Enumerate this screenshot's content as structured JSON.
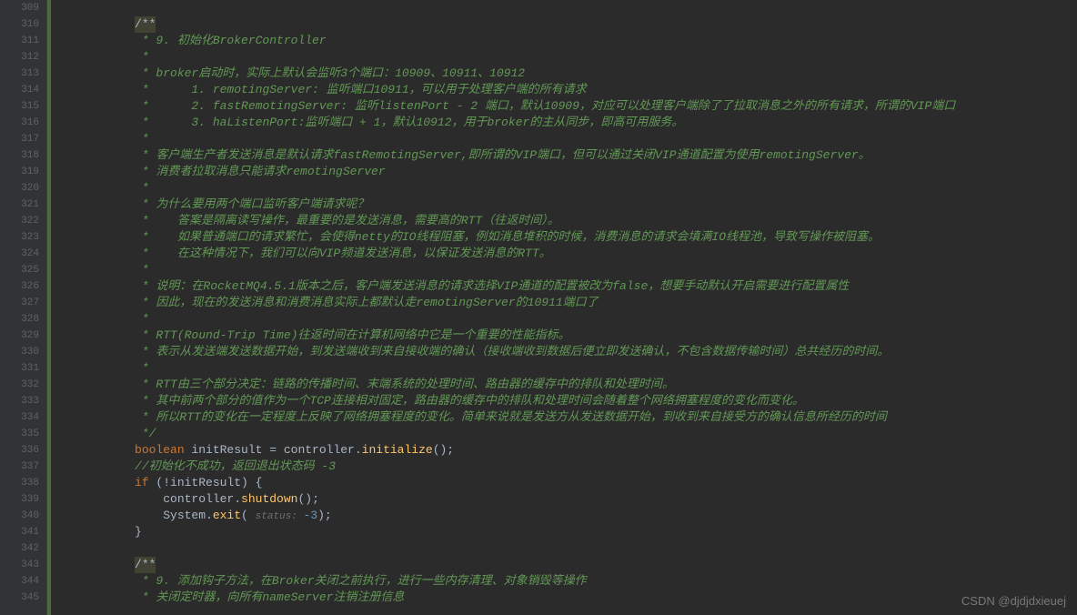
{
  "gutter": {
    "start": 309,
    "end": 345
  },
  "lines": [
    {
      "num": 309,
      "indent": "          ",
      "segments": []
    },
    {
      "num": 310,
      "indent": "          ",
      "segments": [
        {
          "type": "doc-bg",
          "text": "/**"
        }
      ]
    },
    {
      "num": 311,
      "indent": "          ",
      "segments": [
        {
          "type": "doc-comment",
          "text": " * 9. 初始化BrokerController"
        }
      ]
    },
    {
      "num": 312,
      "indent": "          ",
      "segments": [
        {
          "type": "doc-comment",
          "text": " *"
        }
      ]
    },
    {
      "num": 313,
      "indent": "          ",
      "segments": [
        {
          "type": "doc-comment",
          "text": " * broker启动时，实际上默认会监听3个端口：10909、10911、10912"
        }
      ]
    },
    {
      "num": 314,
      "indent": "          ",
      "segments": [
        {
          "type": "doc-comment",
          "text": " *      1. remotingServer: 监听端口10911，可以用于处理客户端的所有请求"
        }
      ]
    },
    {
      "num": 315,
      "indent": "          ",
      "segments": [
        {
          "type": "doc-comment",
          "text": " *      2. fastRemotingServer: 监听listenPort - 2 端口，默认10909，对应可以处理客户端除了了拉取消息之外的所有请求，所谓的VIP端口"
        }
      ]
    },
    {
      "num": 316,
      "indent": "          ",
      "segments": [
        {
          "type": "doc-comment",
          "text": " *      3. haListenPort:监听端口 + 1，默认10912，用于broker的主从同步，即高可用服务。"
        }
      ]
    },
    {
      "num": 317,
      "indent": "          ",
      "segments": [
        {
          "type": "doc-comment",
          "text": " *"
        }
      ]
    },
    {
      "num": 318,
      "indent": "          ",
      "segments": [
        {
          "type": "doc-comment",
          "text": " * 客户端生产者发送消息是默认请求fastRemotingServer,即所谓的VIP端口，但可以通过关闭VIP通道配置为使用remotingServer。"
        }
      ]
    },
    {
      "num": 319,
      "indent": "          ",
      "segments": [
        {
          "type": "doc-comment",
          "text": " * 消费者拉取消息只能请求remotingServer"
        }
      ]
    },
    {
      "num": 320,
      "indent": "          ",
      "segments": [
        {
          "type": "doc-comment",
          "text": " *"
        }
      ]
    },
    {
      "num": 321,
      "indent": "          ",
      "segments": [
        {
          "type": "doc-comment",
          "text": " * 为什么要用两个端口监听客户端请求呢？"
        }
      ]
    },
    {
      "num": 322,
      "indent": "          ",
      "segments": [
        {
          "type": "doc-comment",
          "text": " *    答案是隔离读写操作，最重要的是发送消息，需要高的RTT（往返时间）。"
        }
      ]
    },
    {
      "num": 323,
      "indent": "          ",
      "segments": [
        {
          "type": "doc-comment",
          "text": " *    如果普通端口的请求繁忙，会使得netty的IO线程阻塞，例如消息堆积的时候，消费消息的请求会填满IO线程池，导致写操作被阻塞。"
        }
      ]
    },
    {
      "num": 324,
      "indent": "          ",
      "segments": [
        {
          "type": "doc-comment",
          "text": " *    在这种情况下，我们可以向VIP频道发送消息，以保证发送消息的RTT。"
        }
      ]
    },
    {
      "num": 325,
      "indent": "          ",
      "segments": [
        {
          "type": "doc-comment",
          "text": " *"
        }
      ]
    },
    {
      "num": 326,
      "indent": "          ",
      "segments": [
        {
          "type": "doc-comment",
          "text": " * 说明：在RocketMQ4.5.1版本之后，客户端发送消息的请求选择VIP通道的配置被改为false，想要手动默认开启需要进行配置属性"
        }
      ]
    },
    {
      "num": 327,
      "indent": "          ",
      "segments": [
        {
          "type": "doc-comment",
          "text": " * 因此，现在的发送消息和消费消息实际上都默认走remotingServer的10911端口了"
        }
      ]
    },
    {
      "num": 328,
      "indent": "          ",
      "segments": [
        {
          "type": "doc-comment",
          "text": " *"
        }
      ]
    },
    {
      "num": 329,
      "indent": "          ",
      "segments": [
        {
          "type": "doc-comment",
          "text": " * RTT(Round-Trip Time)往返时间在计算机网络中它是一个重要的性能指标。"
        }
      ]
    },
    {
      "num": 330,
      "indent": "          ",
      "segments": [
        {
          "type": "doc-comment",
          "text": " * 表示从发送端发送数据开始，到发送端收到来自接收端的确认（接收端收到数据后便立即发送确认，不包含数据传输时间）总共经历的时间。"
        }
      ]
    },
    {
      "num": 331,
      "indent": "          ",
      "segments": [
        {
          "type": "doc-comment",
          "text": " *"
        }
      ]
    },
    {
      "num": 332,
      "indent": "          ",
      "segments": [
        {
          "type": "doc-comment",
          "text": " * RTT由三个部分决定：链路的传播时间、末端系统的处理时间、路由器的缓存中的排队和处理时间。"
        }
      ]
    },
    {
      "num": 333,
      "indent": "          ",
      "segments": [
        {
          "type": "doc-comment",
          "text": " * 其中前两个部分的值作为一个TCP连接相对固定，路由器的缓存中的排队和处理时间会随着整个网络拥塞程度的变化而变化。"
        }
      ]
    },
    {
      "num": 334,
      "indent": "          ",
      "segments": [
        {
          "type": "doc-comment",
          "text": " * 所以RTT的变化在一定程度上反映了网络拥塞程度的变化。简单来说就是发送方从发送数据开始，到收到来自接受方的确认信息所经历的时间"
        }
      ]
    },
    {
      "num": 335,
      "indent": "          ",
      "segments": [
        {
          "type": "doc-comment",
          "text": " */"
        }
      ]
    },
    {
      "num": 336,
      "indent": "          ",
      "segments": [
        {
          "type": "keyword",
          "text": "boolean"
        },
        {
          "type": "normal",
          "text": " initResult = controller."
        },
        {
          "type": "method",
          "text": "initialize"
        },
        {
          "type": "normal",
          "text": "();"
        }
      ]
    },
    {
      "num": 337,
      "indent": "          ",
      "segments": [
        {
          "type": "comment",
          "text": "//初始化不成功，返回退出状态码 -3"
        }
      ]
    },
    {
      "num": 338,
      "indent": "          ",
      "segments": [
        {
          "type": "keyword",
          "text": "if"
        },
        {
          "type": "normal",
          "text": " (!initResult) {"
        }
      ]
    },
    {
      "num": 339,
      "indent": "              ",
      "segments": [
        {
          "type": "normal",
          "text": "controller."
        },
        {
          "type": "method",
          "text": "shutdown"
        },
        {
          "type": "normal",
          "text": "();"
        }
      ]
    },
    {
      "num": 340,
      "indent": "              ",
      "segments": [
        {
          "type": "normal",
          "text": "System."
        },
        {
          "type": "method",
          "text": "exit"
        },
        {
          "type": "normal",
          "text": "( "
        },
        {
          "type": "param-hint",
          "text": "status: "
        },
        {
          "type": "string-num",
          "text": "-3"
        },
        {
          "type": "normal",
          "text": ");"
        }
      ]
    },
    {
      "num": 341,
      "indent": "          ",
      "segments": [
        {
          "type": "normal",
          "text": "}"
        }
      ]
    },
    {
      "num": 342,
      "indent": "          ",
      "segments": []
    },
    {
      "num": 343,
      "indent": "          ",
      "segments": [
        {
          "type": "doc-bg",
          "text": "/**"
        }
      ]
    },
    {
      "num": 344,
      "indent": "          ",
      "segments": [
        {
          "type": "doc-comment",
          "text": " * 9. 添加钩子方法，在Broker关闭之前执行，进行一些内存清理、对象销毁等操作"
        }
      ]
    },
    {
      "num": 345,
      "indent": "          ",
      "segments": [
        {
          "type": "doc-comment",
          "text": " * 关闭定时器，向所有nameServer注销注册信息"
        }
      ]
    }
  ],
  "watermark": "CSDN @djdjdxieuej"
}
